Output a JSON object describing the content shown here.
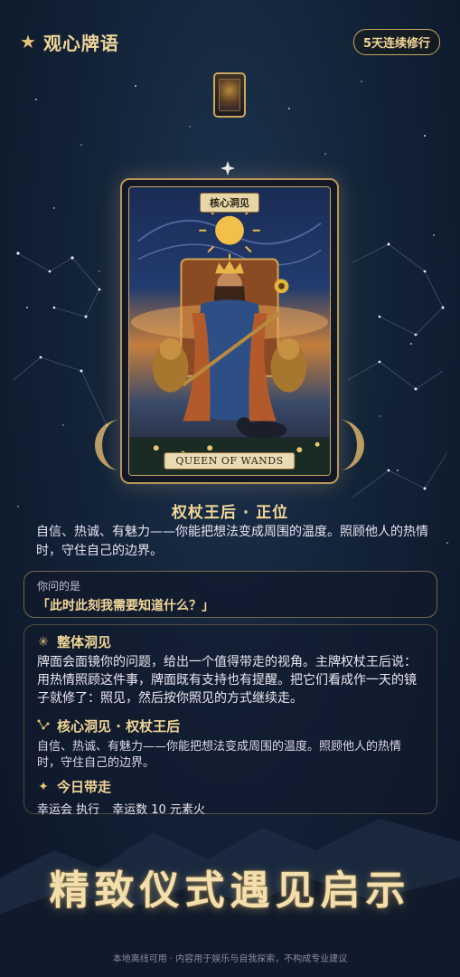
{
  "header": {
    "title": "观心牌语",
    "streak_badge": "5天连续修行"
  },
  "card": {
    "top_label": "核心洞见",
    "bottom_label": "QUEEN OF WANDS",
    "name": "权杖王后 · 正位",
    "description": "自信、热诚、有魅力——你能把想法变成周围的温度。照顾他人的热情时，守住自己的边界。"
  },
  "question": {
    "label": "你问的是",
    "text": "「此时此刻我需要知道什么？」"
  },
  "reading": {
    "overall": {
      "icon": "sparkle-burst-icon",
      "title": "整体洞见",
      "body": "牌面会面镜你的问题，给出一个值得带走的视角。主牌权杖王后说：用热情照顾这件事，牌面既有支持也有提醒。把它们看成作一天的镜子就修了：照见，然后按你照见的方式继续走。"
    },
    "core": {
      "icon": "constellation-icon",
      "title": "核心洞见 · 权杖王后",
      "body": "自信、热诚、有魅力——你能把想法变成周围的温度。照顾他人的热情时，守住自己的边界。"
    },
    "today": {
      "icon": "sparkle-icon",
      "title": "今日带走",
      "lucky_action": "幸运会 执行",
      "lucky_number": "幸运数 10 元素火"
    }
  },
  "slogan": "精致仪式遇见启示",
  "footer": "本地离线可用 · 内容用于娱乐与自我探索，不构成专业建议",
  "colors": {
    "gold": "#f1d796",
    "background": "#132338",
    "accent_border": "#c9a65c"
  }
}
